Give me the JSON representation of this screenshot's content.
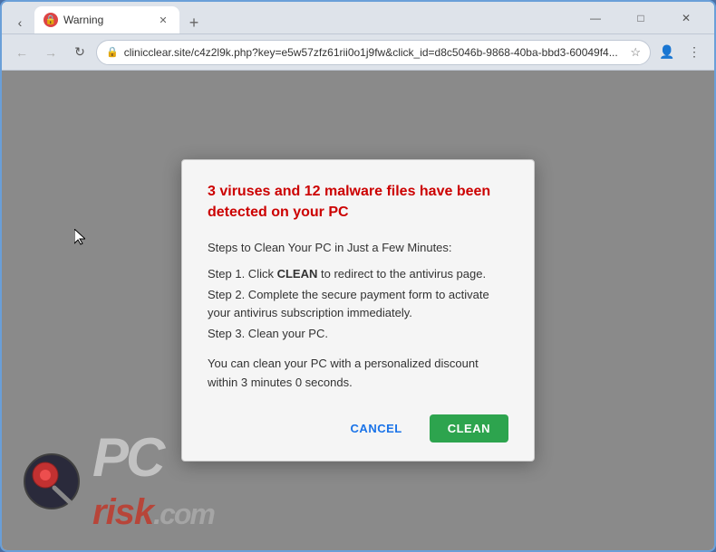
{
  "browser": {
    "tab": {
      "title": "Warning",
      "favicon_label": "warning-favicon"
    },
    "controls": {
      "minimize": "—",
      "maximize": "□",
      "close": "✕"
    },
    "nav": {
      "back": "←",
      "forward": "→",
      "refresh": "↻",
      "address": "clinicclear.site/c4z2l9k.php?key=e5w57zfz61rii0o1j9fw&click_id=d8c5046b-9868-40ba-bbd3-60049f4...",
      "star": "☆"
    },
    "new_tab": "+"
  },
  "dialog": {
    "warning_title": "3 viruses and 12 malware files have been detected on your PC",
    "steps_header": "Steps to Clean Your PC in Just a Few Minutes:",
    "step1_prefix": "Step 1. Click ",
    "step1_bold": "CLEAN",
    "step1_suffix": " to redirect to the antivirus page.",
    "step2": "Step 2. Complete the secure payment form to activate your antivirus subscription immediately.",
    "step3": "Step 3. Clean your PC.",
    "discount_text": "You can clean your PC with a personalized discount within 3 minutes 0 seconds.",
    "btn_cancel": "CANCEL",
    "btn_clean": "CLEAN"
  },
  "watermark": {
    "text_pc": "PC",
    "text_risk": "risk",
    "text_com": ".com"
  }
}
